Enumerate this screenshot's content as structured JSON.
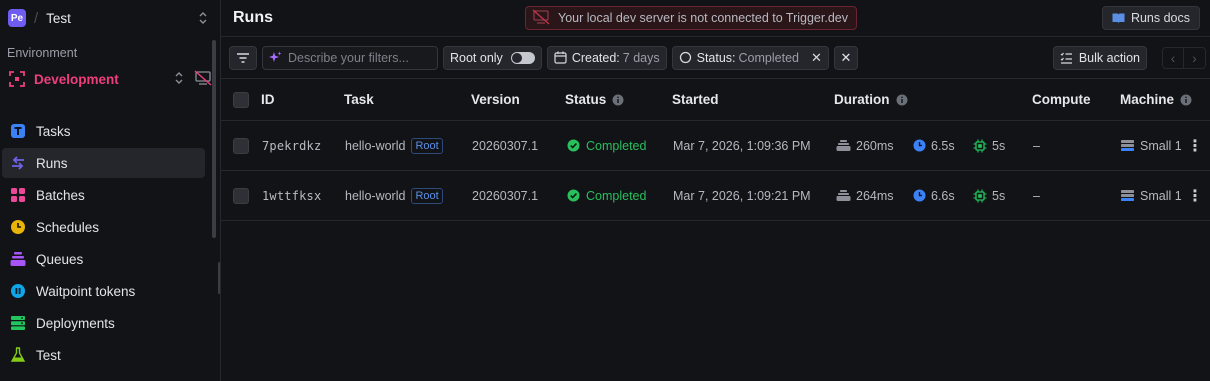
{
  "org": {
    "badge": "Pe",
    "name": "Test"
  },
  "environment": {
    "label": "Environment",
    "name": "Development"
  },
  "nav": [
    {
      "label": "Tasks",
      "icon": "tasks-icon",
      "color": "#3b82f6"
    },
    {
      "label": "Runs",
      "icon": "runs-icon",
      "color": "#6f63e8"
    },
    {
      "label": "Batches",
      "icon": "batches-icon",
      "color": "#ec4899"
    },
    {
      "label": "Schedules",
      "icon": "schedules-icon",
      "color": "#eab308"
    },
    {
      "label": "Queues",
      "icon": "queues-icon",
      "color": "#a855f7"
    },
    {
      "label": "Waitpoint tokens",
      "icon": "waitpoint-icon",
      "color": "#0ea5e9"
    },
    {
      "label": "Deployments",
      "icon": "deployments-icon",
      "color": "#22c55e"
    },
    {
      "label": "Test",
      "icon": "test-flask-icon",
      "color": "#84cc16"
    }
  ],
  "header": {
    "title": "Runs",
    "warning": "Your local dev server is not connected to Trigger.dev",
    "docs_button": "Runs docs"
  },
  "filters": {
    "placeholder": "Describe your filters...",
    "root_only": "Root only",
    "root_only_on": false,
    "created_label": "Created:",
    "created_value": "7 days",
    "status_label": "Status:",
    "status_value": "Completed",
    "bulk_action": "Bulk action"
  },
  "table": {
    "columns": {
      "id": "ID",
      "task": "Task",
      "version": "Version",
      "status": "Status",
      "started": "Started",
      "duration": "Duration",
      "compute": "Compute",
      "machine": "Machine"
    },
    "rows": [
      {
        "id": "7pekrdkz",
        "task": "hello-world",
        "badge": "Root",
        "version": "20260307.1",
        "status": "Completed",
        "started": "Mar 7, 2026, 1:09:36 PM",
        "queued": "260ms",
        "run_time": "6.5s",
        "cpu": "5s",
        "compute": "–",
        "machine": "Small 1"
      },
      {
        "id": "1wttfksx",
        "task": "hello-world",
        "badge": "Root",
        "version": "20260307.1",
        "status": "Completed",
        "started": "Mar 7, 2026, 1:09:21 PM",
        "queued": "264ms",
        "run_time": "6.6s",
        "cpu": "5s",
        "compute": "–",
        "machine": "Small 1"
      }
    ]
  },
  "colors": {
    "accent": "#6f5cf0",
    "env": "#ee3f7b",
    "completed": "#28bf5c",
    "link_badge": "#5b8fe6"
  }
}
